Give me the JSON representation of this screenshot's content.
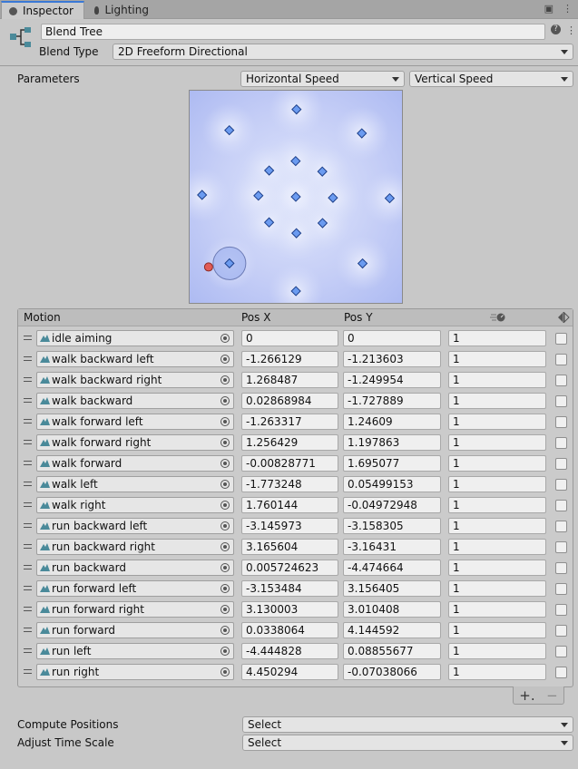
{
  "tabs": [
    {
      "label": "Inspector",
      "icon": "info-icon",
      "active": true
    },
    {
      "label": "Lighting",
      "icon": "lightbulb-icon",
      "active": false
    }
  ],
  "header": {
    "icon": "blend-tree-icon",
    "name": "Blend Tree",
    "blend_type_label": "Blend Type",
    "blend_type_value": "2D Freeform Directional"
  },
  "parameters": {
    "label": "Parameters",
    "x_param": "Horizontal Speed",
    "y_param": "Vertical Speed"
  },
  "table": {
    "headers": {
      "motion": "Motion",
      "posx": "Pos X",
      "posy": "Pos Y",
      "speed_icon": "speed-icon",
      "mirror_icon": "mirror-icon"
    },
    "rows": [
      {
        "motion": "idle aiming",
        "posx": "0",
        "posy": "0",
        "speed": "1",
        "mirror": false
      },
      {
        "motion": "walk backward left",
        "posx": "-1.266129",
        "posy": "-1.213603",
        "speed": "1",
        "mirror": false
      },
      {
        "motion": "walk backward right",
        "posx": "1.268487",
        "posy": "-1.249954",
        "speed": "1",
        "mirror": false
      },
      {
        "motion": "walk backward",
        "posx": "0.02868984",
        "posy": "-1.727889",
        "speed": "1",
        "mirror": false
      },
      {
        "motion": "walk forward left",
        "posx": "-1.263317",
        "posy": "1.24609",
        "speed": "1",
        "mirror": false
      },
      {
        "motion": "walk forward right",
        "posx": "1.256429",
        "posy": "1.197863",
        "speed": "1",
        "mirror": false
      },
      {
        "motion": "walk forward",
        "posx": "-0.00828771",
        "posy": "1.695077",
        "speed": "1",
        "mirror": false
      },
      {
        "motion": "walk left",
        "posx": "-1.773248",
        "posy": "0.05499153",
        "speed": "1",
        "mirror": false
      },
      {
        "motion": "walk right",
        "posx": "1.760144",
        "posy": "-0.04972948",
        "speed": "1",
        "mirror": false
      },
      {
        "motion": "run backward left",
        "posx": "-3.145973",
        "posy": "-3.158305",
        "speed": "1",
        "mirror": false
      },
      {
        "motion": "run backward right",
        "posx": "3.165604",
        "posy": "-3.16431",
        "speed": "1",
        "mirror": false
      },
      {
        "motion": "run backward",
        "posx": "0.005724623",
        "posy": "-4.474664",
        "speed": "1",
        "mirror": false
      },
      {
        "motion": "run forward left",
        "posx": "-3.153484",
        "posy": "3.156405",
        "speed": "1",
        "mirror": false
      },
      {
        "motion": "run forward right",
        "posx": "3.130003",
        "posy": "3.010408",
        "speed": "1",
        "mirror": false
      },
      {
        "motion": "run forward",
        "posx": "0.0338064",
        "posy": "4.144592",
        "speed": "1",
        "mirror": false
      },
      {
        "motion": "run left",
        "posx": "-4.444828",
        "posy": "0.08855677",
        "speed": "1",
        "mirror": false
      },
      {
        "motion": "run right",
        "posx": "4.450294",
        "posy": "-0.07038066",
        "speed": "1",
        "mirror": false
      }
    ],
    "add_button": "+.",
    "remove_button": "−"
  },
  "compute_positions": {
    "label": "Compute Positions",
    "value": "Select"
  },
  "adjust_time_scale": {
    "label": "Adjust Time Scale",
    "value": "Select"
  },
  "colors": {
    "accent": "#3a79d6",
    "diagram_bg": "#c7d0f6",
    "sample_point": "#e25b55"
  }
}
